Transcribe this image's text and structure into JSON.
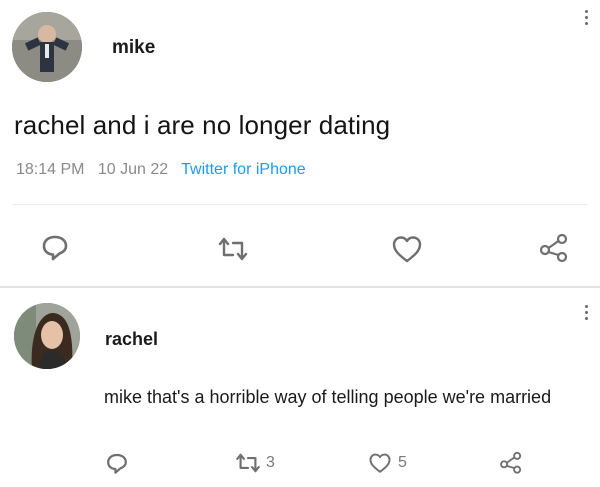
{
  "main_tweet": {
    "author": "mike",
    "text": "rachel and i are no longer dating",
    "time": "18:14 PM",
    "date": "10 Jun 22",
    "source": "Twitter for iPhone",
    "icons": [
      "reply-icon",
      "retweet-icon",
      "like-icon",
      "share-icon",
      "more-icon"
    ]
  },
  "reply": {
    "author": "rachel",
    "text": "mike that's a horrible way of telling people we're married",
    "retweet_count": "3",
    "like_count": "5",
    "icons": [
      "reply-icon",
      "retweet-icon",
      "like-icon",
      "share-icon",
      "more-icon"
    ]
  },
  "colors": {
    "source_link": "#1d9bf0",
    "meta_text": "#8a8a8a",
    "icon": "#6f6f6f"
  }
}
